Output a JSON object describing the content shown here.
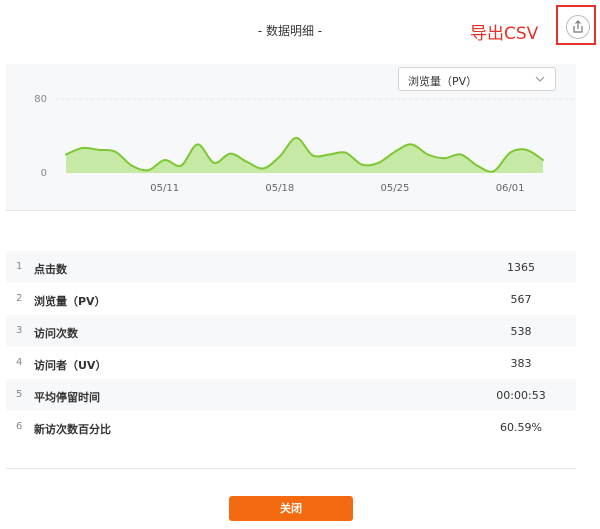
{
  "header": {
    "title": "- 数据明细 -",
    "export_annotation": "导出CSV"
  },
  "colors": {
    "accent": "#f36a10",
    "line": "#7dc832",
    "area": "#c6e9a6",
    "annotation": "#e8302a"
  },
  "icons": {
    "export": "share-upload-icon",
    "dropdown": "chevron-down-icon"
  },
  "metric_select": {
    "selected": "浏览量（PV）"
  },
  "chart_data": {
    "type": "area",
    "title": "",
    "xlabel": "",
    "ylabel": "",
    "ylim": [
      0,
      80
    ],
    "yticks": [
      "80",
      "0"
    ],
    "xticks": [
      {
        "label": "05/11",
        "index": 6
      },
      {
        "label": "05/18",
        "index": 13
      },
      {
        "label": "05/25",
        "index": 20
      },
      {
        "label": "06/01",
        "index": 27
      }
    ],
    "series": [
      {
        "values": [
          20,
          27,
          25,
          23,
          8,
          3,
          14,
          8,
          31,
          11,
          21,
          12,
          5,
          18,
          38,
          19,
          20,
          22,
          9,
          11,
          23,
          31,
          20,
          16,
          20,
          8,
          2,
          22,
          25,
          14
        ]
      }
    ]
  },
  "table": {
    "rows": [
      {
        "index": "1",
        "name": "点击数",
        "value": "1365"
      },
      {
        "index": "2",
        "name": "浏览量（PV）",
        "value": "567"
      },
      {
        "index": "3",
        "name": "访问次数",
        "value": "538"
      },
      {
        "index": "4",
        "name": "访问者（UV）",
        "value": "383"
      },
      {
        "index": "5",
        "name": "平均停留时间",
        "value": "00:00:53"
      },
      {
        "index": "6",
        "name": "新访次数百分比",
        "value": "60.59%"
      }
    ]
  },
  "footer": {
    "close_label": "关闭"
  }
}
